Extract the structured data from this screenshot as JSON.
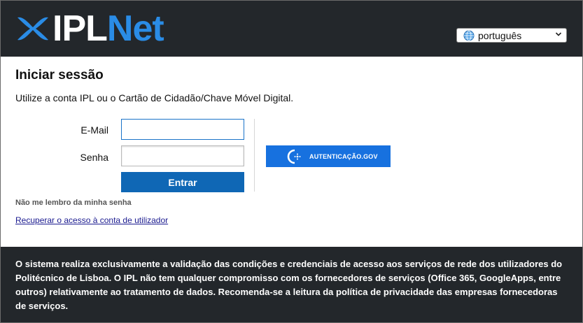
{
  "header": {
    "logo": {
      "part1": "IPL",
      "part2": "Net"
    },
    "language": {
      "selected": "português",
      "icon": "globe-icon"
    }
  },
  "login": {
    "title": "Iniciar sessão",
    "intro": "Utilize a conta IPL ou o Cartão de Cidadão/Chave Móvel Digital.",
    "email_label": "E-Mail",
    "email_value": "",
    "password_label": "Senha",
    "password_value": "",
    "submit_label": "Entrar",
    "gov_button_label": "AUTENTICAÇÃO.GOV",
    "forgot_text": "Não me lembro da minha senha",
    "recover_link": "Recuperar o acesso à conta de utilizador"
  },
  "footer": {
    "notice": "O sistema realiza exclusivamente a validação das condições e credenciais de acesso aos serviços de rede dos utilizadores do Politécnico de Lisboa. O IPL não tem qualquer compromisso com os fornecedores de serviços (Office 365, GoogleApps, entre outros) relativamente ao tratamento de dados. Recomenda-se a leitura da política de privacidade das empresas fornecedoras de serviços."
  },
  "colors": {
    "header_bg": "#23272b",
    "brand_blue": "#2a8ce6",
    "button_blue": "#0f67b5",
    "gov_blue": "#1771df"
  }
}
